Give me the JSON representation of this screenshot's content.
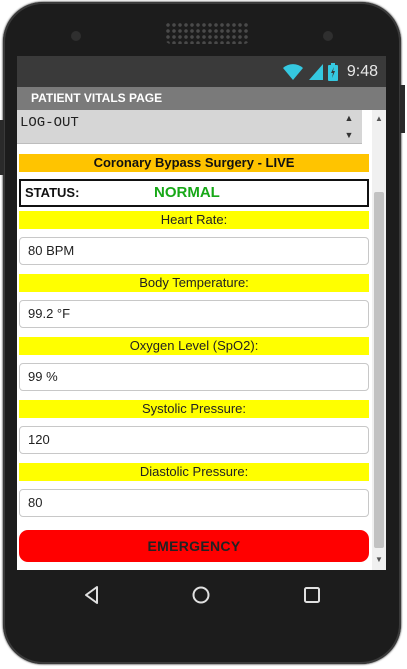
{
  "status_bar": {
    "time": "9:48"
  },
  "app": {
    "title": "PATIENT VITALS PAGE"
  },
  "logout": {
    "label": "LOG-OUT"
  },
  "surgery": {
    "label": "Coronary Bypass Surgery - LIVE"
  },
  "status": {
    "label": "STATUS:",
    "value": "NORMAL",
    "value_color": "#17a817"
  },
  "vitals": {
    "heart_rate": {
      "label": "Heart Rate:",
      "value": "80 BPM"
    },
    "temperature": {
      "label": "Body Temperature:",
      "value": "99.2 °F"
    },
    "oxygen": {
      "label": "Oxygen Level (SpO2):",
      "value": "99 %"
    },
    "systolic": {
      "label": "Systolic Pressure:",
      "value": "120"
    },
    "diastolic": {
      "label": "Diastolic Pressure:",
      "value": "80"
    }
  },
  "emergency": {
    "label": "EMERGENCY",
    "color": "#ff0000"
  },
  "colors": {
    "label_bg": "#ffff00",
    "surgery_bg": "#ffc400",
    "title_bg": "#7a7a7a"
  },
  "icons": [
    "wifi-icon",
    "signal-icon",
    "battery-icon",
    "back-icon",
    "home-icon",
    "recents-icon"
  ]
}
